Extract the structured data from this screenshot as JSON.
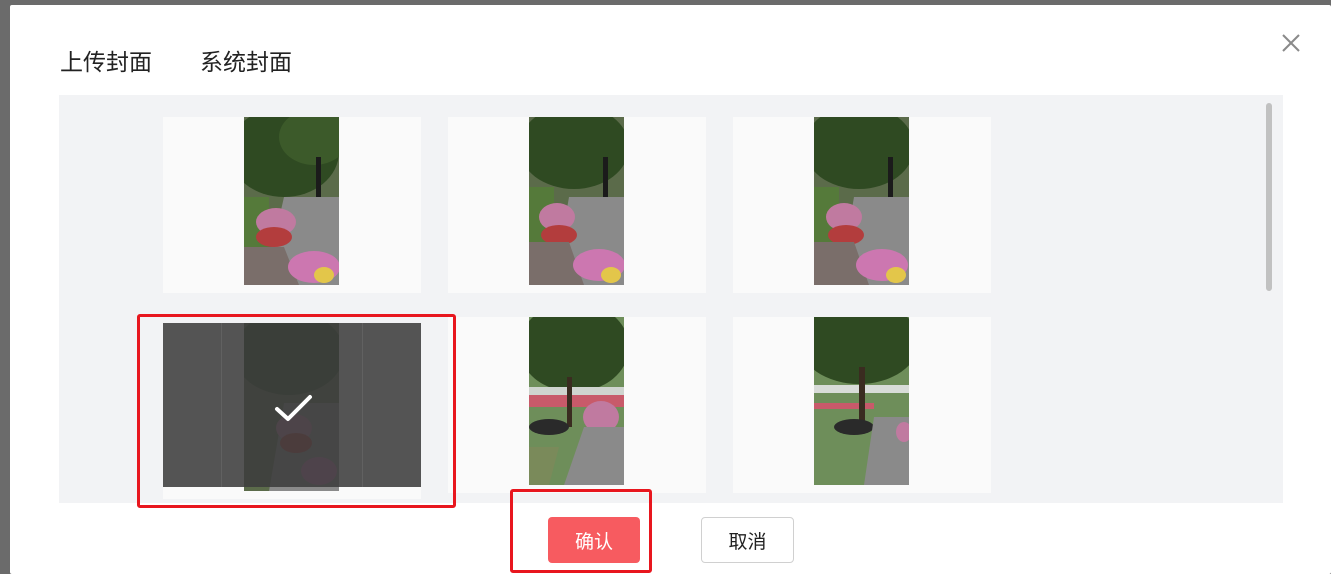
{
  "dialog": {
    "tabs": [
      {
        "label": "上传封面",
        "active": false
      },
      {
        "label": "系统封面",
        "active": true
      }
    ],
    "close_icon": "close-icon"
  },
  "covers": [
    {
      "id": 1,
      "selected": false
    },
    {
      "id": 2,
      "selected": false
    },
    {
      "id": 3,
      "selected": false
    },
    {
      "id": 4,
      "selected": true
    },
    {
      "id": 5,
      "selected": false
    },
    {
      "id": 6,
      "selected": false
    }
  ],
  "footer": {
    "confirm_label": "确认",
    "cancel_label": "取消"
  },
  "colors": {
    "accent": "#f75b60",
    "highlight_frame": "#e8161e",
    "tab_underline": "#f5424a"
  }
}
